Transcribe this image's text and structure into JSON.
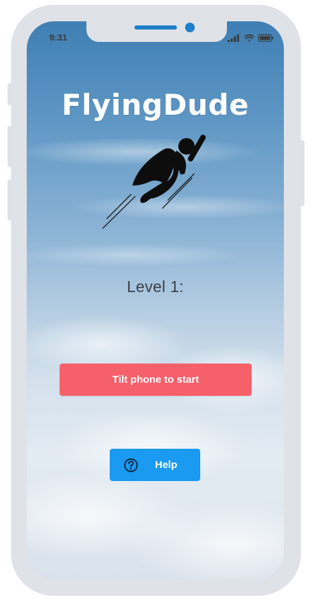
{
  "status_bar": {
    "time": "9:31",
    "icons": [
      "signal-icon",
      "wifi-icon",
      "battery-icon"
    ]
  },
  "app": {
    "title": "FlyingDude",
    "hero_icon": "flying-superhero-icon",
    "level_label": "Level 1:"
  },
  "actions": {
    "start_label": "Tilt phone to start",
    "help_label": "Help",
    "help_icon": "question-circle-icon"
  },
  "colors": {
    "start_button": "#f5606b",
    "help_button": "#1a9af0",
    "device_frame": "#dfe2e7",
    "speaker_camera": "#1f7fc9"
  }
}
